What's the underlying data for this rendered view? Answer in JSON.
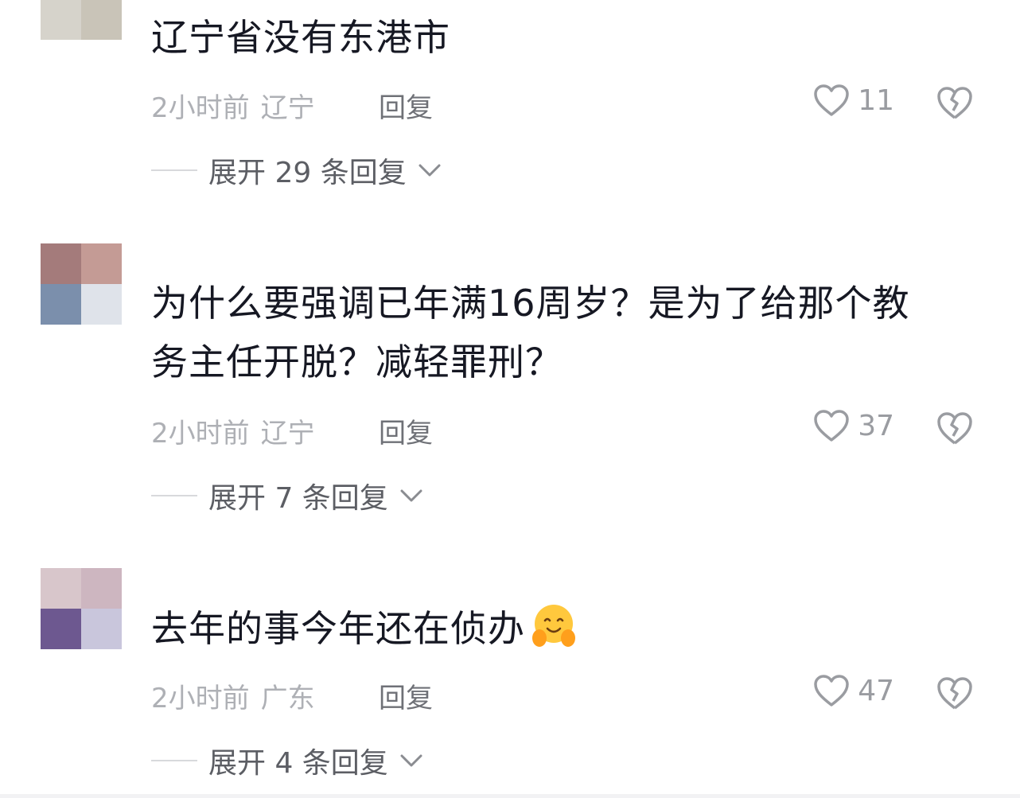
{
  "comments": [
    {
      "text": "辽宁省没有东港市",
      "time": "2小时前",
      "location": "辽宁",
      "reply_label": "回复",
      "likes": "11",
      "expand_label": "展开 29 条回复"
    },
    {
      "text": "为什么要强调已年满16周岁？是为了给那个教务主任开脱？减轻罪刑？",
      "time": "2小时前",
      "location": "辽宁",
      "reply_label": "回复",
      "likes": "37",
      "expand_label": "展开 7 条回复"
    },
    {
      "text": "去年的事今年还在侦办",
      "emoji": "smiling-face-hands-on-cheeks",
      "time": "2小时前",
      "location": "广东",
      "reply_label": "回复",
      "likes": "47",
      "expand_label": "展开 4 条回复"
    }
  ],
  "colors": {
    "text": "#161823",
    "meta": "#aeb0b5",
    "icon": "#9a9ca1"
  },
  "icons": {
    "like": "heart-outline-icon",
    "dislike": "broken-heart-icon",
    "expand": "chevron-down-icon"
  }
}
